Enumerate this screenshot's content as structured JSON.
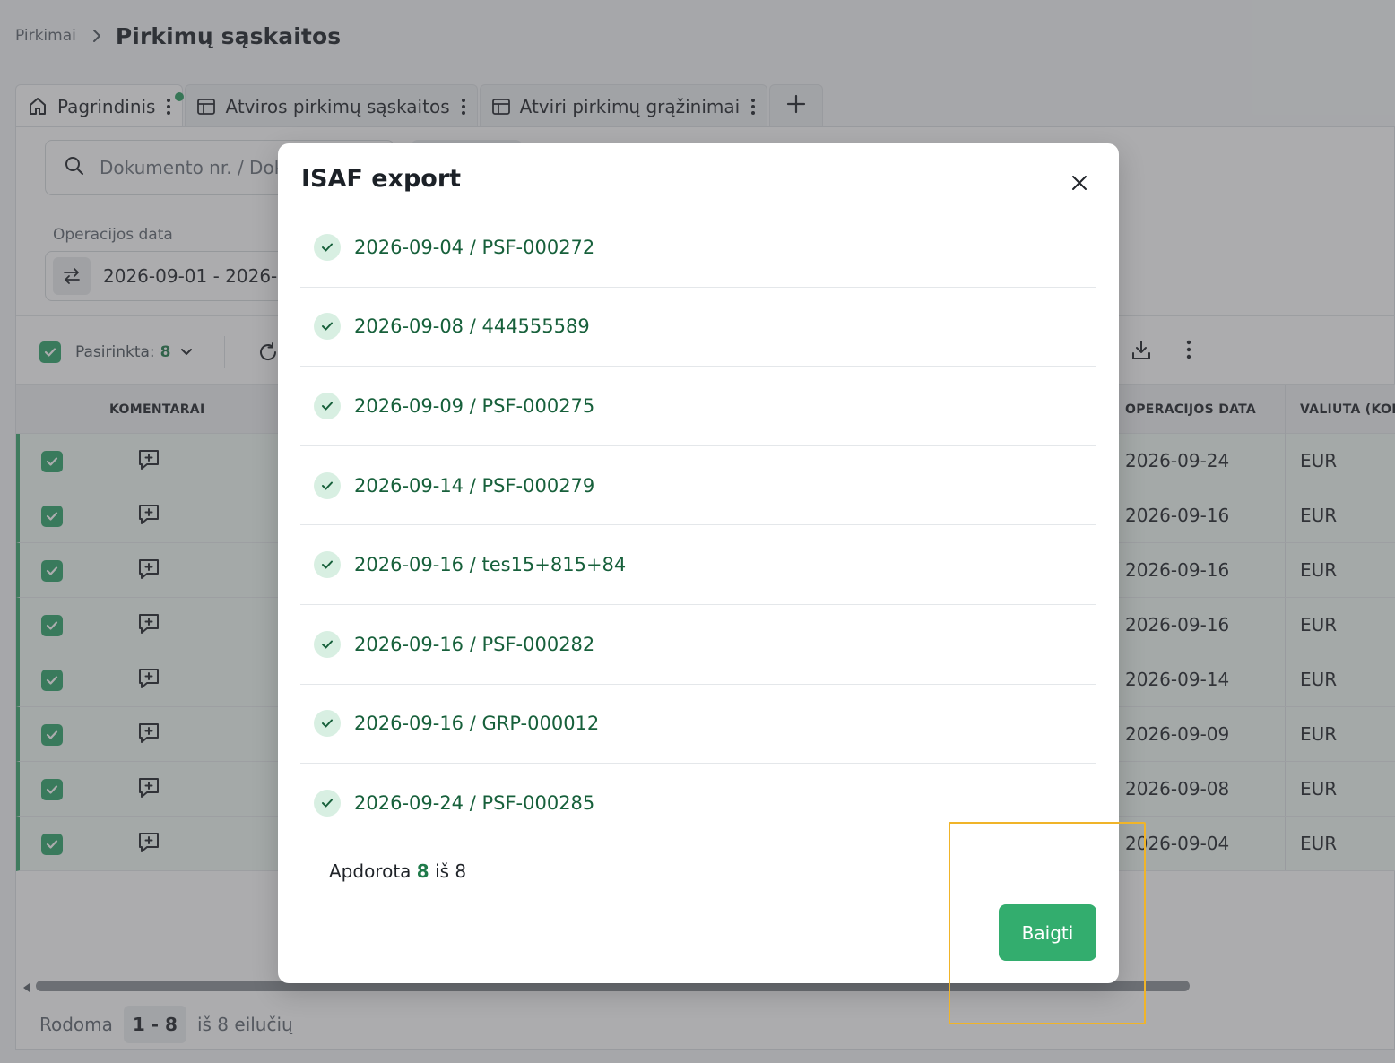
{
  "breadcrumb": {
    "parent": "Pirkimai",
    "current": "Pirkimų sąskaitos"
  },
  "tabs": [
    {
      "label": "Pagrindinis",
      "icon": "home-icon"
    },
    {
      "label": "Atviros pirkimų sąskaitos",
      "icon": "table-icon"
    },
    {
      "label": "Atviri pirkimų grąžinimai",
      "icon": "table-icon"
    }
  ],
  "search": {
    "placeholder": "Dokumento nr. / Dok"
  },
  "filters": {
    "date_label": "Operacijos data",
    "date_value": "2026-09-01 - 2026-"
  },
  "toolbar": {
    "selected_label": "Pasirinkta:",
    "selected_count": "8"
  },
  "table": {
    "headers": {
      "comments": "KOMENTARAI",
      "operation_date": "OPERACIJOS DATA",
      "currency": "VALIUTA (KOD"
    },
    "rows": [
      {
        "date": "2026-09-24",
        "currency": "EUR"
      },
      {
        "date": "2026-09-16",
        "currency": "EUR"
      },
      {
        "date": "2026-09-16",
        "currency": "EUR"
      },
      {
        "date": "2026-09-16",
        "currency": "EUR"
      },
      {
        "date": "2026-09-14",
        "currency": "EUR"
      },
      {
        "date": "2026-09-09",
        "currency": "EUR"
      },
      {
        "date": "2026-09-08",
        "currency": "EUR"
      },
      {
        "date": "2026-09-04",
        "currency": "EUR"
      }
    ]
  },
  "footer": {
    "showing_label": "Rodoma",
    "range": "1 - 8",
    "of_label": "iš 8 eilučių"
  },
  "modal": {
    "title": "ISAF export",
    "items": [
      "2026-09-04 / PSF-000272",
      "2026-09-08 / 444555589",
      "2026-09-09 / PSF-000275",
      "2026-09-14 / PSF-000279",
      "2026-09-16 / tes15+815+84",
      "2026-09-16 / PSF-000282",
      "2026-09-16 / GRP-000012",
      "2026-09-24 / PSF-000285"
    ],
    "progress_prefix": "Apdorota",
    "progress_done": "8",
    "progress_suffix": "iš 8",
    "finish_label": "Baigti"
  },
  "colors": {
    "accent": "#33ad6e",
    "check_text": "#17603b",
    "highlight": "#f0b429"
  }
}
